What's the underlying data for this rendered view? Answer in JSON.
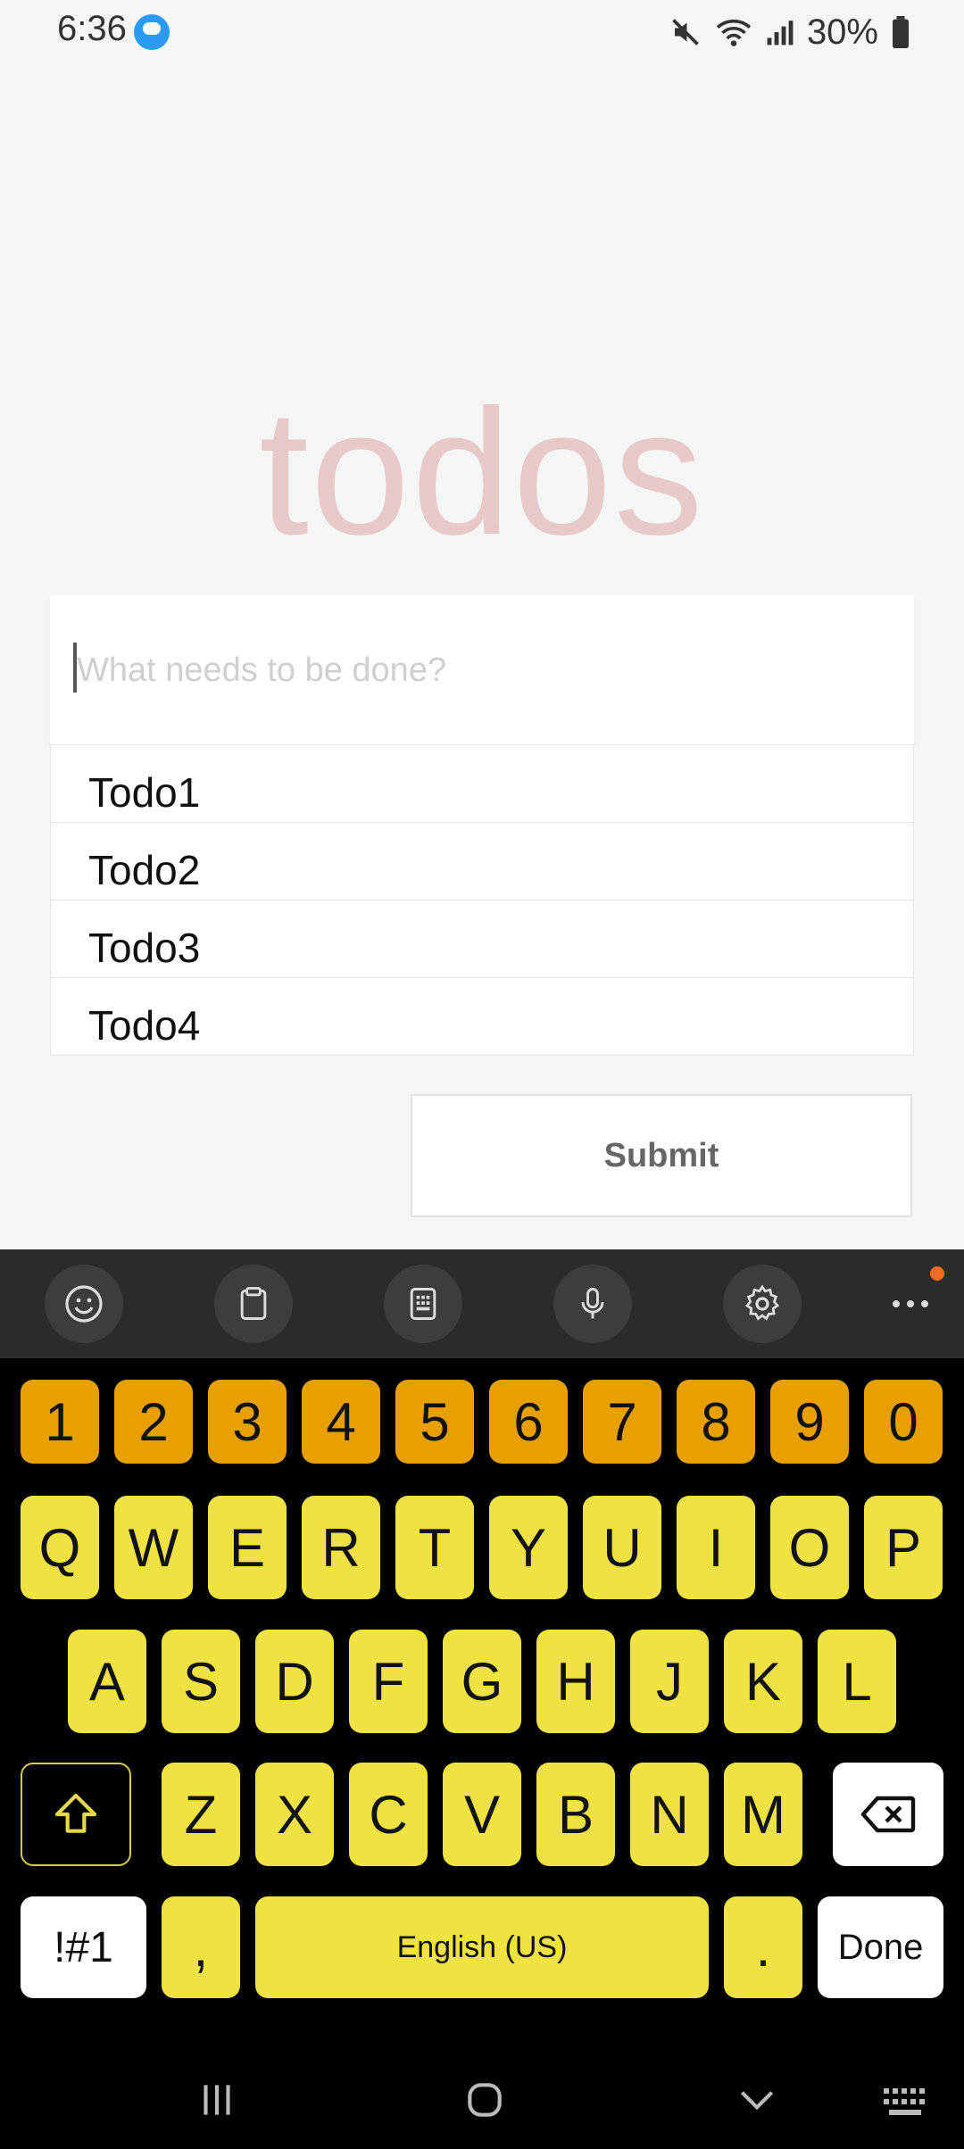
{
  "status_bar": {
    "time": "6:36",
    "battery": "30%",
    "icons": [
      "cloud-app-icon",
      "mute-icon",
      "wifi-icon",
      "signal-icon",
      "battery-icon"
    ]
  },
  "app": {
    "title": "todos",
    "input_placeholder": "What needs to be done?",
    "input_value": "",
    "todos": [
      "Todo1",
      "Todo2",
      "Todo3",
      "Todo4"
    ],
    "submit_label": "Submit"
  },
  "keyboard": {
    "toolbar": [
      "emoji-icon",
      "clipboard-icon",
      "keypad-icon",
      "mic-icon",
      "settings-icon",
      "more-icon"
    ],
    "row_numbers": [
      "1",
      "2",
      "3",
      "4",
      "5",
      "6",
      "7",
      "8",
      "9",
      "0"
    ],
    "row_1": [
      "Q",
      "W",
      "E",
      "R",
      "T",
      "Y",
      "U",
      "I",
      "O",
      "P"
    ],
    "row_2": [
      "A",
      "S",
      "D",
      "F",
      "G",
      "H",
      "J",
      "K",
      "L"
    ],
    "row_3": [
      "Z",
      "X",
      "C",
      "V",
      "B",
      "N",
      "M"
    ],
    "symbols_label": "!#1",
    "comma_label": ",",
    "space_label": "English (US)",
    "period_label": ".",
    "done_label": "Done",
    "colors": {
      "number_keys": "#e8a000",
      "letter_keys": "#f1e244",
      "background": "#000000"
    }
  },
  "nav_bar": {
    "icons": [
      "recents-icon",
      "home-icon",
      "back-icon",
      "keyboard-switch-icon"
    ]
  }
}
